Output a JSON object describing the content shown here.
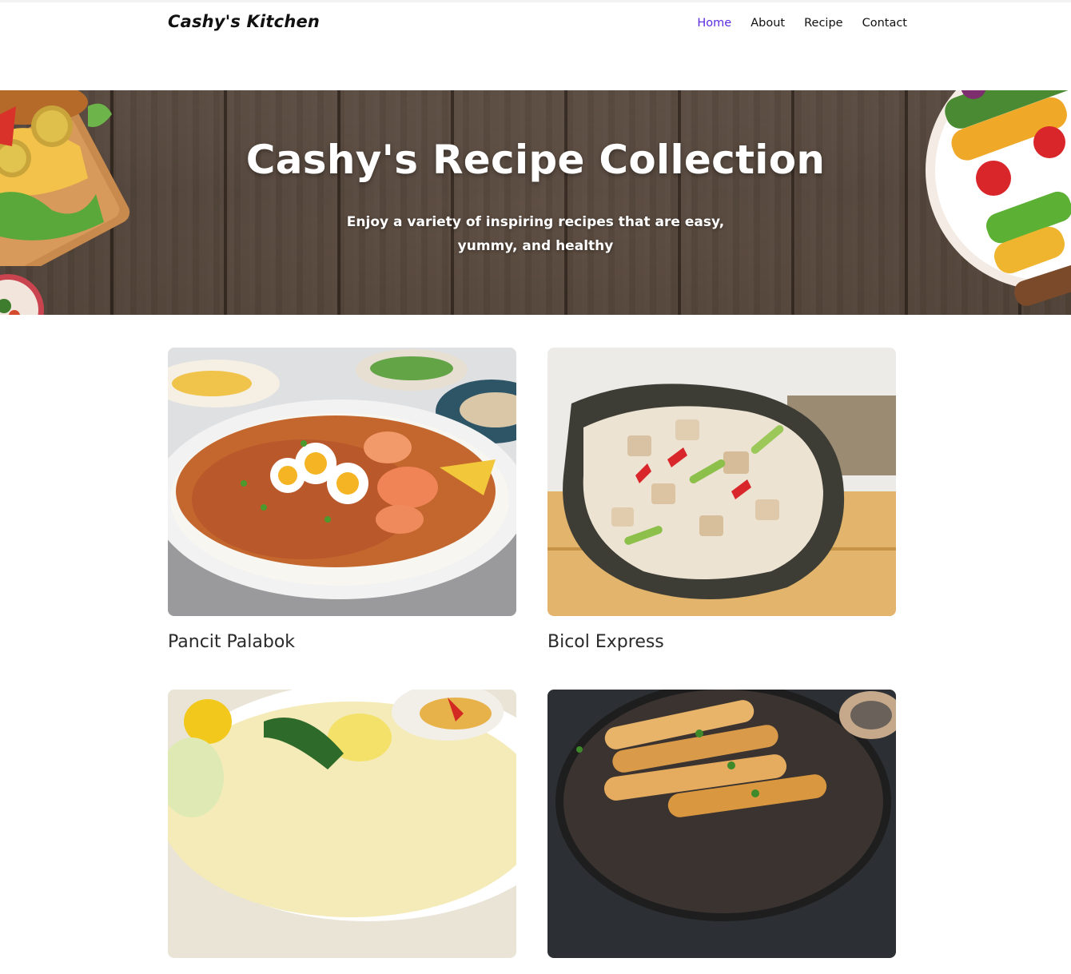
{
  "brand": "Cashy's Kitchen",
  "nav": {
    "items": [
      {
        "label": "Home",
        "active": true
      },
      {
        "label": "About",
        "active": false
      },
      {
        "label": "Recipe",
        "active": false
      },
      {
        "label": "Contact",
        "active": false
      }
    ]
  },
  "hero": {
    "title": "Cashy's Recipe Collection",
    "subtitle": "Enjoy a variety of inspiring recipes that are easy, yummy, and healthy"
  },
  "recipes": [
    {
      "title": "Pancit Palabok",
      "image": "pancit-palabok-photo"
    },
    {
      "title": "Bicol Express",
      "image": "bicol-express-photo"
    },
    {
      "title": "",
      "image": "nilaga-soup-photo"
    },
    {
      "title": "",
      "image": "lumpia-photo"
    }
  ],
  "colors": {
    "accent": "#5b2be0",
    "text": "#111111",
    "hero_wood": "#6e5c4f"
  }
}
